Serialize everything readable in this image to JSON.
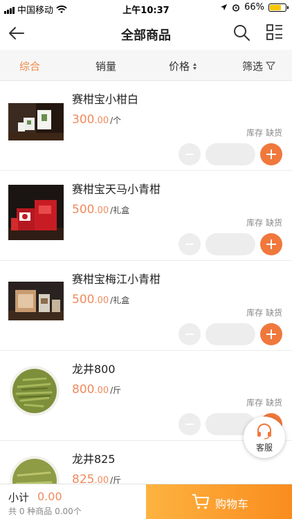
{
  "status_bar": {
    "carrier": "中国移动",
    "time": "上午10:37",
    "battery": "66%"
  },
  "nav": {
    "title": "全部商品"
  },
  "filters": [
    {
      "label": "综合",
      "active": true
    },
    {
      "label": "销量",
      "active": false
    },
    {
      "label": "价格",
      "active": false
    },
    {
      "label": "筛选",
      "active": false
    }
  ],
  "products": [
    {
      "name": "赛柑宝小柑白",
      "price_int": "300",
      "price_dec": ".00",
      "unit": "/个",
      "stock_label": "库存",
      "stock_status": "缺货"
    },
    {
      "name": "赛柑宝天马小青柑",
      "price_int": "500",
      "price_dec": ".00",
      "unit": "/礼盒",
      "stock_label": "库存",
      "stock_status": "缺货"
    },
    {
      "name": "赛柑宝梅江小青柑",
      "price_int": "500",
      "price_dec": ".00",
      "unit": "/礼盒",
      "stock_label": "库存",
      "stock_status": "缺货"
    },
    {
      "name": "龙井800",
      "price_int": "800",
      "price_dec": ".00",
      "unit": "/斤",
      "stock_label": "库存",
      "stock_status": "缺货"
    },
    {
      "name": "龙井825",
      "price_int": "825",
      "price_dec": ".00",
      "unit": "/斤",
      "stock_label": "",
      "stock_status": ""
    }
  ],
  "customer_service": {
    "label": "客服"
  },
  "bottom": {
    "subtotal_label": "小计",
    "subtotal_value": "0.00",
    "summary": "共 0 种商品 0.00个",
    "cart_label": "购物车"
  },
  "colors": {
    "accent": "#f08a4b",
    "price": "#f08a5d",
    "plus": "#f0783c",
    "cart_gradient_start": "#fdb341",
    "cart_gradient_end": "#fa8c1e"
  }
}
